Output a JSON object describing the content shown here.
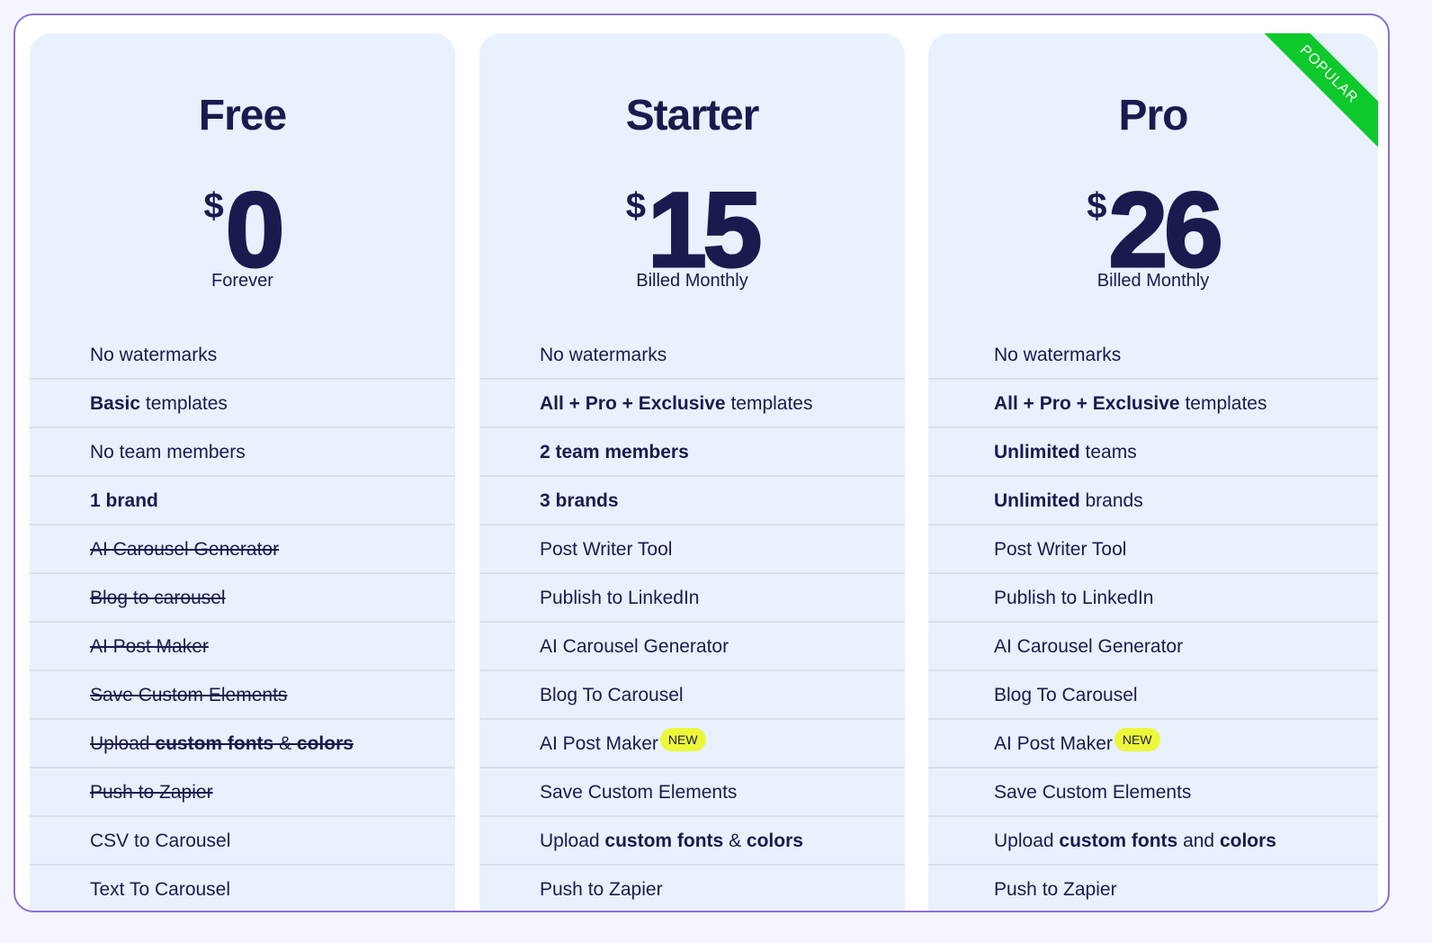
{
  "colors": {
    "text": "#1b1a4f",
    "card_bg": "#e8f1fd",
    "frame_border": "#8a6fd8",
    "popular_ribbon": "#0ec92c",
    "new_badge": "#ecf73a"
  },
  "plans": [
    {
      "name": "Free",
      "currency": "$",
      "price": "0",
      "period": "Forever",
      "features": [
        {
          "parts": [
            {
              "text": "No watermarks",
              "bold": false
            }
          ],
          "struck": false
        },
        {
          "parts": [
            {
              "text": "Basic",
              "bold": true
            },
            {
              "text": " templates",
              "bold": false
            }
          ],
          "struck": false
        },
        {
          "parts": [
            {
              "text": "No team members",
              "bold": false
            }
          ],
          "struck": false
        },
        {
          "parts": [
            {
              "text": "1 brand",
              "bold": true
            }
          ],
          "struck": false
        },
        {
          "parts": [
            {
              "text": "AI Carousel Generator",
              "bold": false
            }
          ],
          "struck": true
        },
        {
          "parts": [
            {
              "text": "Blog to carousel",
              "bold": false
            }
          ],
          "struck": true
        },
        {
          "parts": [
            {
              "text": "AI Post Maker",
              "bold": false
            }
          ],
          "struck": true
        },
        {
          "parts": [
            {
              "text": "Save Custom Elements",
              "bold": false
            }
          ],
          "struck": true
        },
        {
          "parts": [
            {
              "text": "Upload ",
              "bold": false
            },
            {
              "text": "custom fonts",
              "bold": true
            },
            {
              "text": " & ",
              "bold": false
            },
            {
              "text": "colors",
              "bold": true
            }
          ],
          "struck": true
        },
        {
          "parts": [
            {
              "text": "Push to Zapier",
              "bold": false
            }
          ],
          "struck": true
        },
        {
          "parts": [
            {
              "text": "CSV to Carousel",
              "bold": false
            }
          ],
          "struck": false
        },
        {
          "parts": [
            {
              "text": "Text To Carousel",
              "bold": false
            }
          ],
          "struck": false
        }
      ]
    },
    {
      "name": "Starter",
      "currency": "$",
      "price": "15",
      "period": "Billed Monthly",
      "features": [
        {
          "parts": [
            {
              "text": "No watermarks",
              "bold": false
            }
          ],
          "struck": false
        },
        {
          "parts": [
            {
              "text": "All + Pro + Exclusive",
              "bold": true
            },
            {
              "text": " templates",
              "bold": false
            }
          ],
          "struck": false
        },
        {
          "parts": [
            {
              "text": "2 team members",
              "bold": true
            }
          ],
          "struck": false
        },
        {
          "parts": [
            {
              "text": "3 brands",
              "bold": true
            }
          ],
          "struck": false
        },
        {
          "parts": [
            {
              "text": "Post Writer Tool",
              "bold": false
            }
          ],
          "struck": false
        },
        {
          "parts": [
            {
              "text": "Publish to LinkedIn",
              "bold": false
            }
          ],
          "struck": false
        },
        {
          "parts": [
            {
              "text": "AI Carousel Generator",
              "bold": false
            }
          ],
          "struck": false
        },
        {
          "parts": [
            {
              "text": "Blog To Carousel",
              "bold": false
            }
          ],
          "struck": false
        },
        {
          "parts": [
            {
              "text": "AI Post Maker",
              "bold": false
            }
          ],
          "struck": false,
          "badge": "NEW"
        },
        {
          "parts": [
            {
              "text": "Save Custom Elements",
              "bold": false
            }
          ],
          "struck": false
        },
        {
          "parts": [
            {
              "text": "Upload ",
              "bold": false
            },
            {
              "text": "custom fonts",
              "bold": true
            },
            {
              "text": " & ",
              "bold": false
            },
            {
              "text": "colors",
              "bold": true
            }
          ],
          "struck": false
        },
        {
          "parts": [
            {
              "text": "Push to Zapier",
              "bold": false
            }
          ],
          "struck": false
        }
      ]
    },
    {
      "name": "Pro",
      "currency": "$",
      "price": "26",
      "period": "Billed Monthly",
      "ribbon": "POPULAR",
      "features": [
        {
          "parts": [
            {
              "text": "No watermarks",
              "bold": false
            }
          ],
          "struck": false
        },
        {
          "parts": [
            {
              "text": "All + Pro + Exclusive",
              "bold": true
            },
            {
              "text": " templates",
              "bold": false
            }
          ],
          "struck": false
        },
        {
          "parts": [
            {
              "text": "Unlimited",
              "bold": true
            },
            {
              "text": " teams",
              "bold": false
            }
          ],
          "struck": false
        },
        {
          "parts": [
            {
              "text": "Unlimited",
              "bold": true
            },
            {
              "text": " brands",
              "bold": false
            }
          ],
          "struck": false
        },
        {
          "parts": [
            {
              "text": "Post Writer Tool",
              "bold": false
            }
          ],
          "struck": false
        },
        {
          "parts": [
            {
              "text": "Publish to LinkedIn",
              "bold": false
            }
          ],
          "struck": false
        },
        {
          "parts": [
            {
              "text": "AI Carousel Generator",
              "bold": false
            }
          ],
          "struck": false
        },
        {
          "parts": [
            {
              "text": "Blog To Carousel",
              "bold": false
            }
          ],
          "struck": false
        },
        {
          "parts": [
            {
              "text": "AI Post Maker",
              "bold": false
            }
          ],
          "struck": false,
          "badge": "NEW"
        },
        {
          "parts": [
            {
              "text": "Save Custom Elements",
              "bold": false
            }
          ],
          "struck": false
        },
        {
          "parts": [
            {
              "text": "Upload ",
              "bold": false
            },
            {
              "text": "custom fonts",
              "bold": true
            },
            {
              "text": " and ",
              "bold": false
            },
            {
              "text": "colors",
              "bold": true
            }
          ],
          "struck": false
        },
        {
          "parts": [
            {
              "text": "Push to Zapier",
              "bold": false
            }
          ],
          "struck": false
        }
      ]
    }
  ]
}
